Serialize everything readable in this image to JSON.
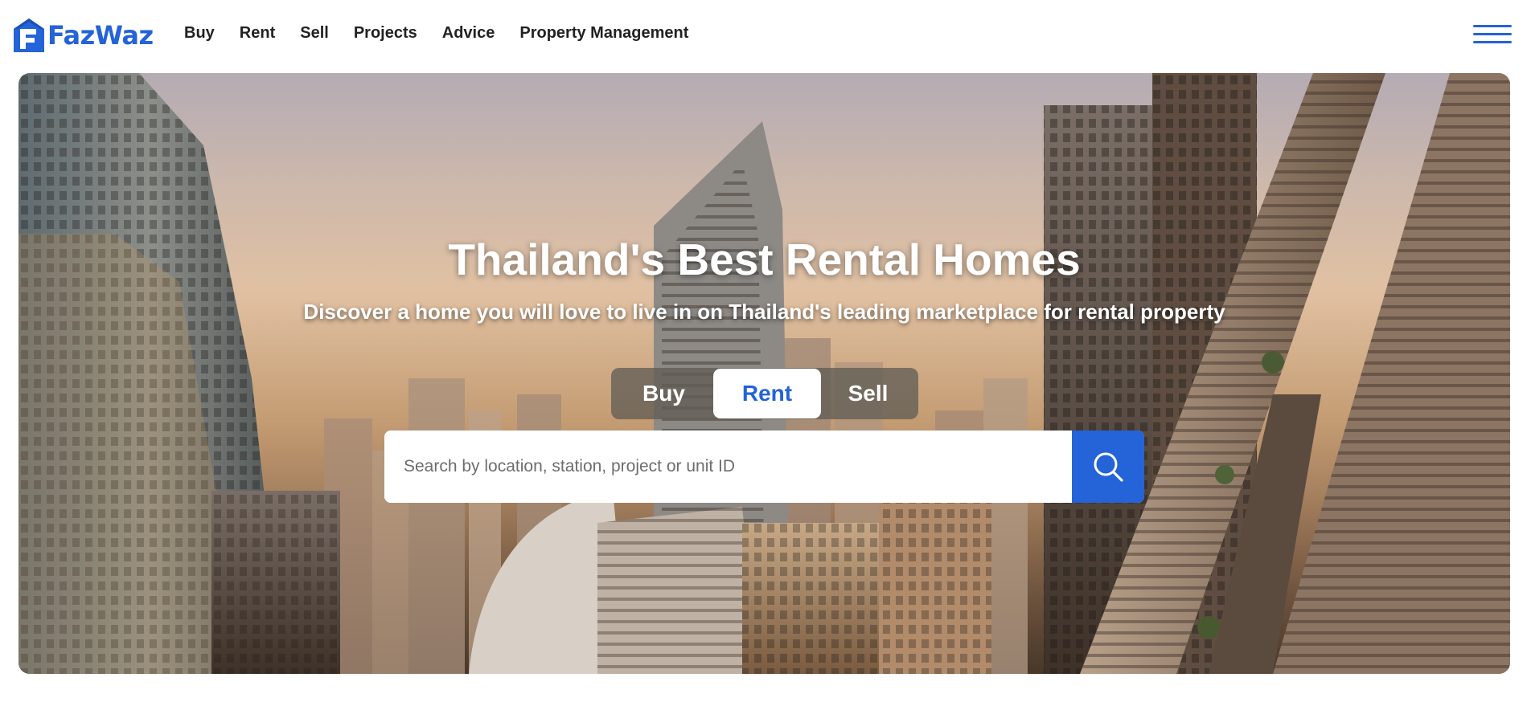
{
  "brand": {
    "name": "FazWaz",
    "color": "#2463d8"
  },
  "nav": {
    "items": [
      {
        "label": "Buy"
      },
      {
        "label": "Rent"
      },
      {
        "label": "Sell"
      },
      {
        "label": "Projects"
      },
      {
        "label": "Advice"
      },
      {
        "label": "Property Management"
      }
    ],
    "menu_icon": "hamburger-menu-icon"
  },
  "hero": {
    "title": "Thailand's Best Rental Homes",
    "subtitle": "Discover a home you will love to live in on Thailand's leading marketplace for rental property",
    "modes": [
      {
        "label": "Buy",
        "selected": false
      },
      {
        "label": "Rent",
        "selected": true
      },
      {
        "label": "Sell",
        "selected": false
      }
    ],
    "search": {
      "placeholder": "Search by location, station, project or unit ID",
      "value": "",
      "button_icon": "search-icon"
    }
  }
}
